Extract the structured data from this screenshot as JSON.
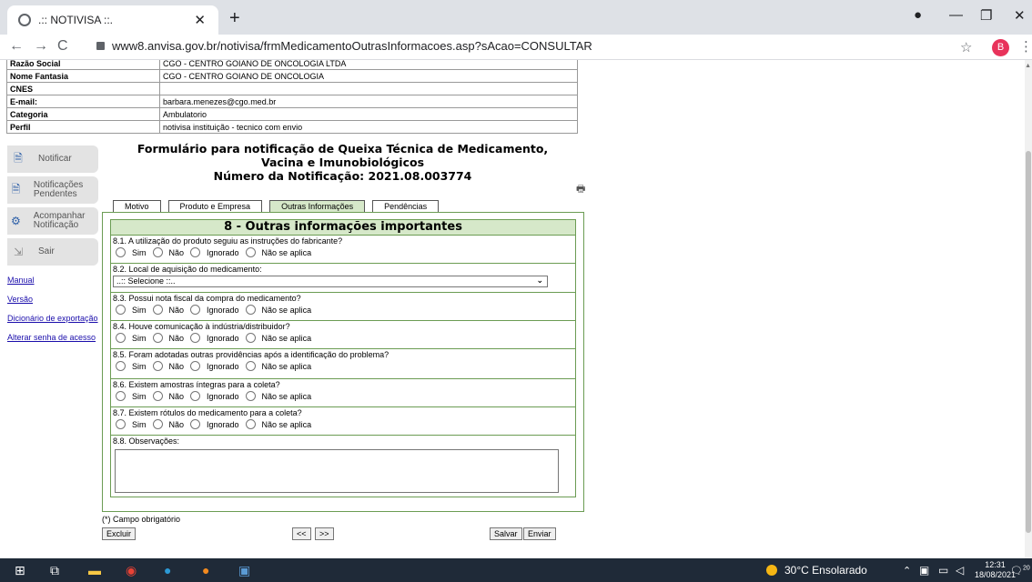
{
  "browser": {
    "tab_title": ".:: NOTIVISA ::.",
    "url": "www8.anvisa.gov.br/notivisa/frmMedicamentoOutrasInformacoes.asp?sAcao=CONSULTAR",
    "avatar_letter": "B"
  },
  "info_table": [
    {
      "key": "Razão Social",
      "value": "CGO - CENTRO GOIANO DE ONCOLOGIA LTDA"
    },
    {
      "key": "Nome Fantasia",
      "value": "CGO - CENTRO GOIANO DE ONCOLOGIA"
    },
    {
      "key": "CNES",
      "value": ""
    },
    {
      "key": "E-mail:",
      "value": "barbara.menezes@cgo.med.br"
    },
    {
      "key": "Categoria",
      "value": "Ambulatorio"
    },
    {
      "key": "Perfil",
      "value": "notivisa instituição - tecnico com envio"
    }
  ],
  "sidebar": {
    "buttons": [
      {
        "label": "Notificar",
        "icon": "document-icon"
      },
      {
        "label": "Notificações Pendentes",
        "icon": "pending-document-icon"
      },
      {
        "label": "Acompanhar Notificação",
        "icon": "follow-up-icon"
      },
      {
        "label": "Sair",
        "icon": "exit-icon"
      }
    ],
    "links": [
      "Manual",
      "Versão",
      "Dicionário de exportação",
      "Alterar senha de acesso"
    ]
  },
  "form": {
    "title_line1": "Formulário para notificação de Queixa Técnica de Medicamento,",
    "title_line2": "Vacina e Imunobiológicos",
    "title_line3": "Número da Notificação: 2021.08.003774",
    "tabs": [
      "Motivo",
      "Produto e Empresa",
      "Outras Informações",
      "Pendências"
    ],
    "active_tab": "Outras Informações",
    "section_title": "8 - Outras informações importantes",
    "radio_options": [
      "Sim",
      "Não",
      "Ignorado",
      "Não se aplica"
    ],
    "questions": {
      "q1": "8.1. A utilização do produto seguiu as instruções do fabricante?",
      "q2": "8.2. Local de aquisição do medicamento:",
      "q2_select": "..:: Selecione ::..",
      "q3": "8.3. Possui nota fiscal da compra do medicamento?",
      "q4": "8.4. Houve comunicação à indústria/distribuidor?",
      "q5": "8.5. Foram adotadas outras providências após a identificação do problema?",
      "q6": "8.6. Existem amostras íntegras para a coleta?",
      "q7": "8.7. Existem rótulos do medicamento para a coleta?",
      "q8": "8.8. Observações:"
    },
    "required_note": "(*) Campo obrigatório",
    "buttons": {
      "delete": "Excluir",
      "prev": "<<",
      "next": ">>",
      "save": "Salvar",
      "send": "Enviar"
    }
  },
  "taskbar": {
    "weather": "30°C Ensolarado",
    "time": "12:31",
    "date": "18/08/2021",
    "notif_count": "20"
  }
}
